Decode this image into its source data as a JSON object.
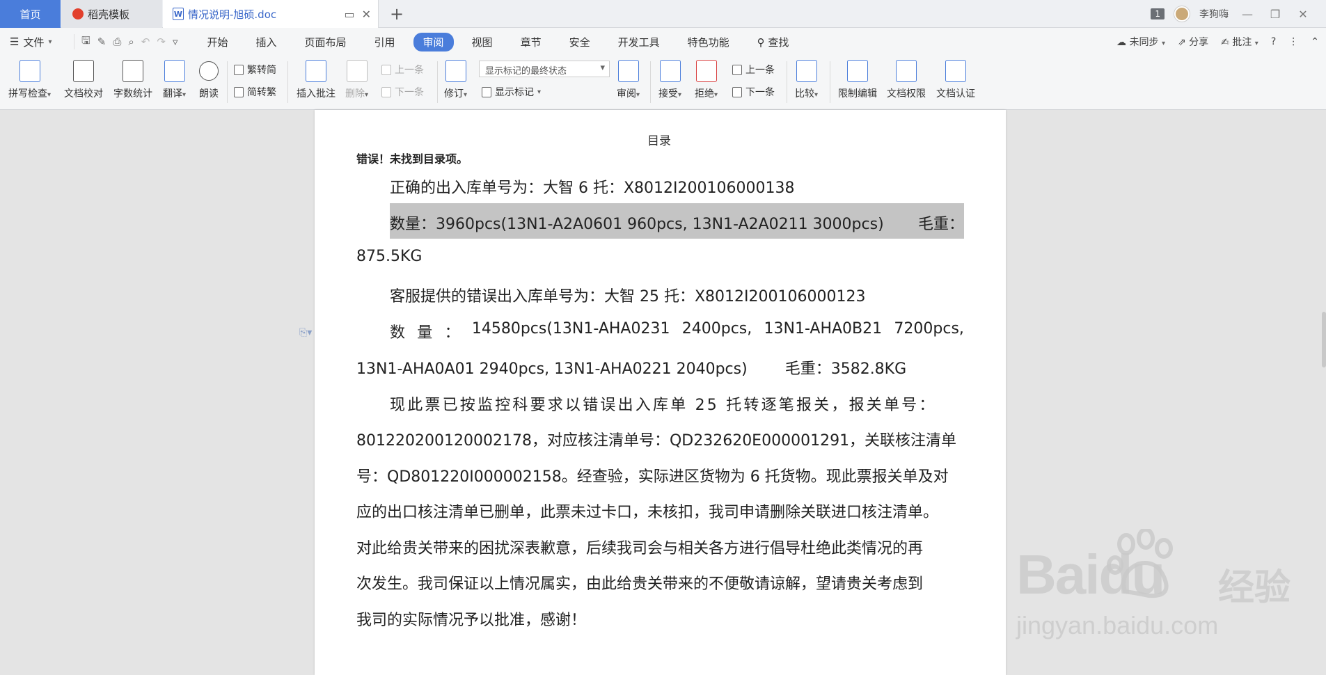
{
  "titlebar": {
    "tabs": [
      {
        "label": "首页"
      },
      {
        "label": "稻壳模板"
      },
      {
        "label": "情况说明-旭硕.doc"
      }
    ],
    "new_tab_symbol": "+",
    "page_count": "1",
    "user_name": "李狗嗨"
  },
  "menubar": {
    "file_label": "文件",
    "tabs": [
      "开始",
      "插入",
      "页面布局",
      "引用",
      "审阅",
      "视图",
      "章节",
      "安全",
      "开发工具",
      "特色功能"
    ],
    "active_tab": "审阅",
    "search_label": "查找",
    "sync_label": "未同步",
    "share_label": "分享",
    "annotate_label": "批注",
    "help_symbol": "?"
  },
  "ribbon": {
    "spell_check": "拼写检查",
    "doc_proof": "文档校对",
    "word_count": "字数统计",
    "translate": "翻译",
    "read_aloud": "朗读",
    "trad_to_simp": "繁转简",
    "simp_to_trad": "简转繁",
    "insert_comment": "插入批注",
    "delete": "删除",
    "prev_comment": "上一条",
    "next_comment": "下一条",
    "track_changes": "修订",
    "display_state": "显示标记的最终状态",
    "show_markup": "显示标记",
    "review": "审阅",
    "accept": "接受",
    "reject": "拒绝",
    "prev_change": "上一条",
    "next_change": "下一条",
    "compare": "比较",
    "restrict_edit": "限制编辑",
    "doc_permission": "文档权限",
    "doc_certify": "文档认证"
  },
  "document": {
    "toc_title": "目录",
    "toc_error": "错误！未找到目录项。",
    "line1": "正确的出入库单号为：大智 6 托：X8012I200106000138",
    "line2a": "数量：3960pcs(13N1-A2A0601 960pcs, 13N1-A2A0211 3000pcs)",
    "line2b": "毛重：",
    "line3": "875.5KG",
    "line4": "客服提供的错误出入库单号为：大智 25 托：X8012I200106000123",
    "line5_parts": [
      "数",
      "量",
      "：",
      "14580pcs(13N1-AHA0231",
      "2400pcs,",
      "13N1-AHA0B21",
      "7200pcs,"
    ],
    "line6": "13N1-AHA0A01 2940pcs, 13N1-AHA0221 2040pcs)",
    "line6b": "毛重：3582.8KG",
    "line7": "现此票已按监控科要求以错误出入库单 25 托转逐笔报关，报关单号：",
    "line8": "801220200120002178，对应核注清单号：QD232620E000001291，关联核注清单",
    "line9": "号：QD801220I000002158。经查验，实际进区货物为 6 托货物。现此票报关单及对",
    "line10": "应的出口核注清单已删单，此票未过卡口，未核扣，我司申请删除关联进口核注清单。",
    "line11": "对此给贵关带来的困扰深表歉意，后续我司会与相关各方进行倡导杜绝此类情况的再",
    "line12": "次发生。我司保证以上情况属实，由此给贵关带来的不便敬请谅解，望请贵关考虑到",
    "line13": "我司的实际情况予以批准，感谢！"
  },
  "watermark": {
    "brand": "Baidu",
    "brand_cn": "经验",
    "url": "jingyan.baidu.com"
  },
  "colors": {
    "accent": "#4a7ddb",
    "highlight": "#c4c4c4",
    "page_bg": "#ffffff",
    "workspace_bg": "#e4e4e4"
  }
}
